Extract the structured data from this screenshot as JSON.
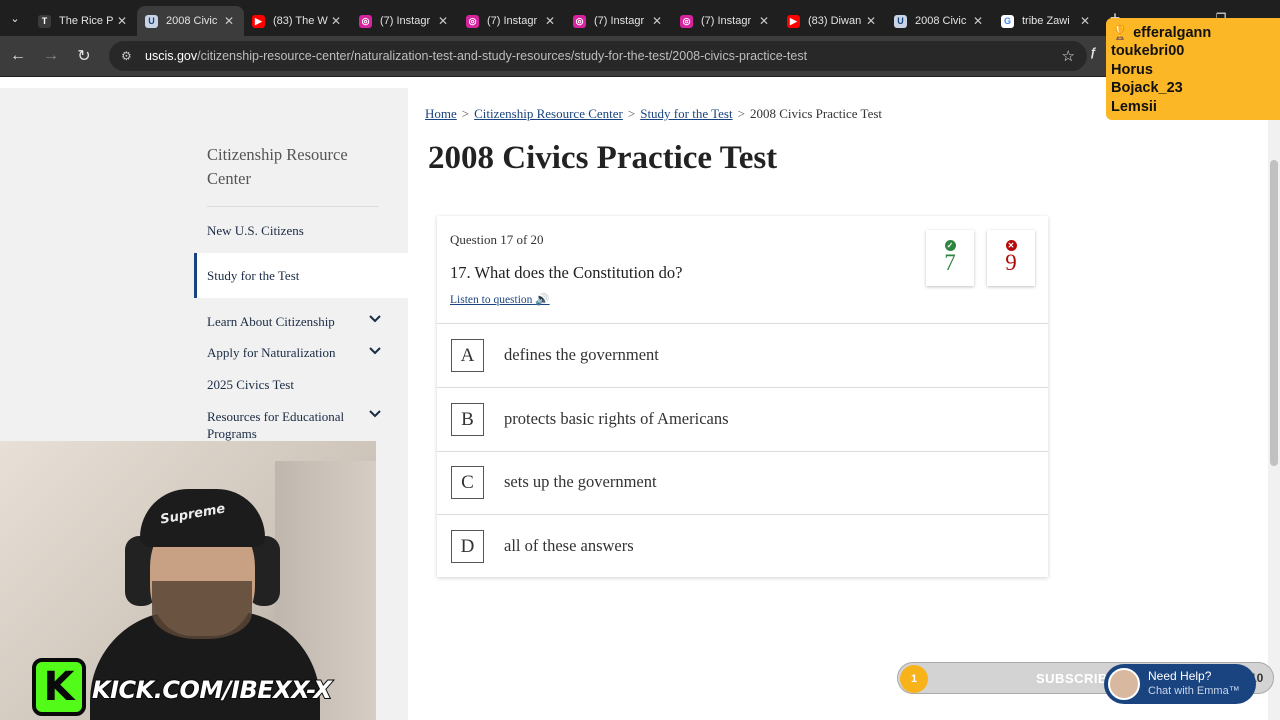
{
  "browser": {
    "tabs": [
      {
        "title": "The Rice P",
        "favicon": "T",
        "favicon_color": "#3b3b3b"
      },
      {
        "title": "2008 Civic",
        "favicon": "U",
        "favicon_color": "#c8d4e6",
        "active": true
      },
      {
        "title": "(83) The W",
        "favicon": "▶",
        "favicon_color": "#ff0000"
      },
      {
        "title": "(7) Instagr",
        "favicon": "◎",
        "favicon_color": "#d6249f"
      },
      {
        "title": "(7) Instagr",
        "favicon": "◎",
        "favicon_color": "#d6249f"
      },
      {
        "title": "(7) Instagr",
        "favicon": "◎",
        "favicon_color": "#d6249f"
      },
      {
        "title": "(7) Instagr",
        "favicon": "◎",
        "favicon_color": "#d6249f"
      },
      {
        "title": "(83) Diwan",
        "favicon": "▶",
        "favicon_color": "#ff0000"
      },
      {
        "title": "2008 Civic",
        "favicon": "U",
        "favicon_color": "#c8d4e6"
      },
      {
        "title": "tribe Zawi",
        "favicon": "G",
        "favicon_color": "#ffffff"
      }
    ],
    "url_host": "uscis.gov",
    "url_path": "/citizenship-resource-center/naturalization-test-and-study-resources/study-for-the-test/2008-civics-practice-test"
  },
  "sidebar": {
    "title": "Citizenship Resource Center",
    "items": [
      {
        "label": "New U.S. Citizens"
      },
      {
        "label": "Study for the Test",
        "active": true
      },
      {
        "label": "Learn About Citizenship",
        "expandable": true
      },
      {
        "label": "Apply for Naturalization",
        "expandable": true
      },
      {
        "label": "2025 Civics Test"
      },
      {
        "label": "Resources for Educational Programs",
        "expandable": true
      }
    ]
  },
  "breadcrumb": {
    "home": "Home",
    "crc": "Citizenship Resource Center",
    "study": "Study for the Test",
    "current": "2008 Civics Practice Test"
  },
  "page": {
    "title": "2008 Civics Practice Test"
  },
  "quiz": {
    "progress": "Question 17 of 20",
    "question": "17. What does the Constitution do?",
    "listen_label": "Listen to question",
    "correct_count": "7",
    "incorrect_count": "9",
    "answers": [
      {
        "letter": "A",
        "text": "defines the government"
      },
      {
        "letter": "B",
        "text": "protects basic rights of Americans"
      },
      {
        "letter": "C",
        "text": "sets up the government"
      },
      {
        "letter": "D",
        "text": "all of these answers"
      }
    ]
  },
  "overlay": {
    "chat_users": [
      "efferalgann",
      "toukebri00",
      "Horus",
      "Bojack_23",
      "Lemsii"
    ],
    "kick_url": "KICK.COM/IBEXX-X",
    "subscribers_label": "SUBSCRIBERS",
    "subscribers_count": "1",
    "subscribers_goal": "10",
    "help_line1": "Need Help?",
    "help_line2": "Chat with Emma™"
  },
  "colors": {
    "link": "#1a4480",
    "correct": "#2e8540",
    "incorrect": "#b50909",
    "chat_bg": "#fbb725",
    "kick_green": "#53fc18"
  }
}
